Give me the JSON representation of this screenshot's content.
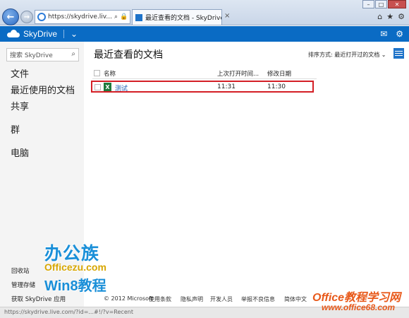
{
  "browser": {
    "address": "https://skydrive.liv...",
    "tab_title": "最近查看的文档 - SkyDrive",
    "tab_close": "×"
  },
  "header": {
    "brand": "SkyDrive"
  },
  "sidebar": {
    "search_placeholder": "搜索 SkyDrive",
    "nav": [
      "文件",
      "最近使用的文档",
      "共享",
      "群",
      "电脑"
    ],
    "bottom_links": [
      "回收站",
      "管理存储",
      "获取 SkyDrive 应用"
    ]
  },
  "main": {
    "title": "最近查看的文档",
    "sort_label": "排序方式: 最近打开过的文档",
    "columns": [
      "名称",
      "上次打开时间...",
      "修改日期"
    ],
    "rows": [
      {
        "name": "测试",
        "last_opened": "11:31",
        "modified": "11:30"
      }
    ]
  },
  "footer": {
    "links": [
      "© 2012 Microsoft",
      "使用条款",
      "隐私声明",
      "开发人员",
      "举报不良信息",
      "简体中文"
    ]
  },
  "status": {
    "url": "https://skydrive.live.com/?id=...#!/?v=Recent"
  },
  "watermark": {
    "line1": "办公族",
    "line2": "Officezu.com",
    "line3": "Win8教程",
    "line4": "Office教程学习网",
    "line5": "www.office68.com"
  },
  "colors": {
    "brand_blue": "#0a6bc4",
    "highlight_red": "#d41f26",
    "excel_green": "#1f7a3d"
  }
}
